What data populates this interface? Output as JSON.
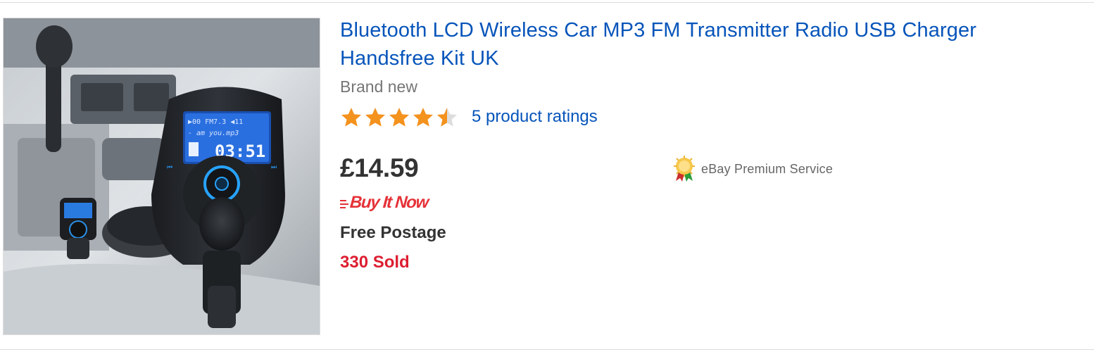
{
  "listing": {
    "image_alt": "Car FM transmitter product photo",
    "title": "Bluetooth LCD Wireless Car MP3 FM Transmitter Radio USB Charger Handsfree Kit UK",
    "condition": "Brand new",
    "rating": {
      "stars": 4.5,
      "max": 5,
      "count_label": "5 product ratings"
    },
    "price": "£14.59",
    "buy_format": "Buy It Now",
    "postage": "Free Postage",
    "sold": "330 Sold",
    "badge": {
      "label": "eBay Premium Service",
      "icon": "premium-seal-icon"
    }
  },
  "device_screen": {
    "line1": "▶00 FM7.3  ◀11",
    "line2": "- am you.mp3",
    "time": "03:51"
  },
  "colors": {
    "link": "#0654ba",
    "price": "#333333",
    "sold": "#dd1e31",
    "buy_it_now": "#e53238",
    "star": "#f4921e",
    "condition": "#767676"
  }
}
